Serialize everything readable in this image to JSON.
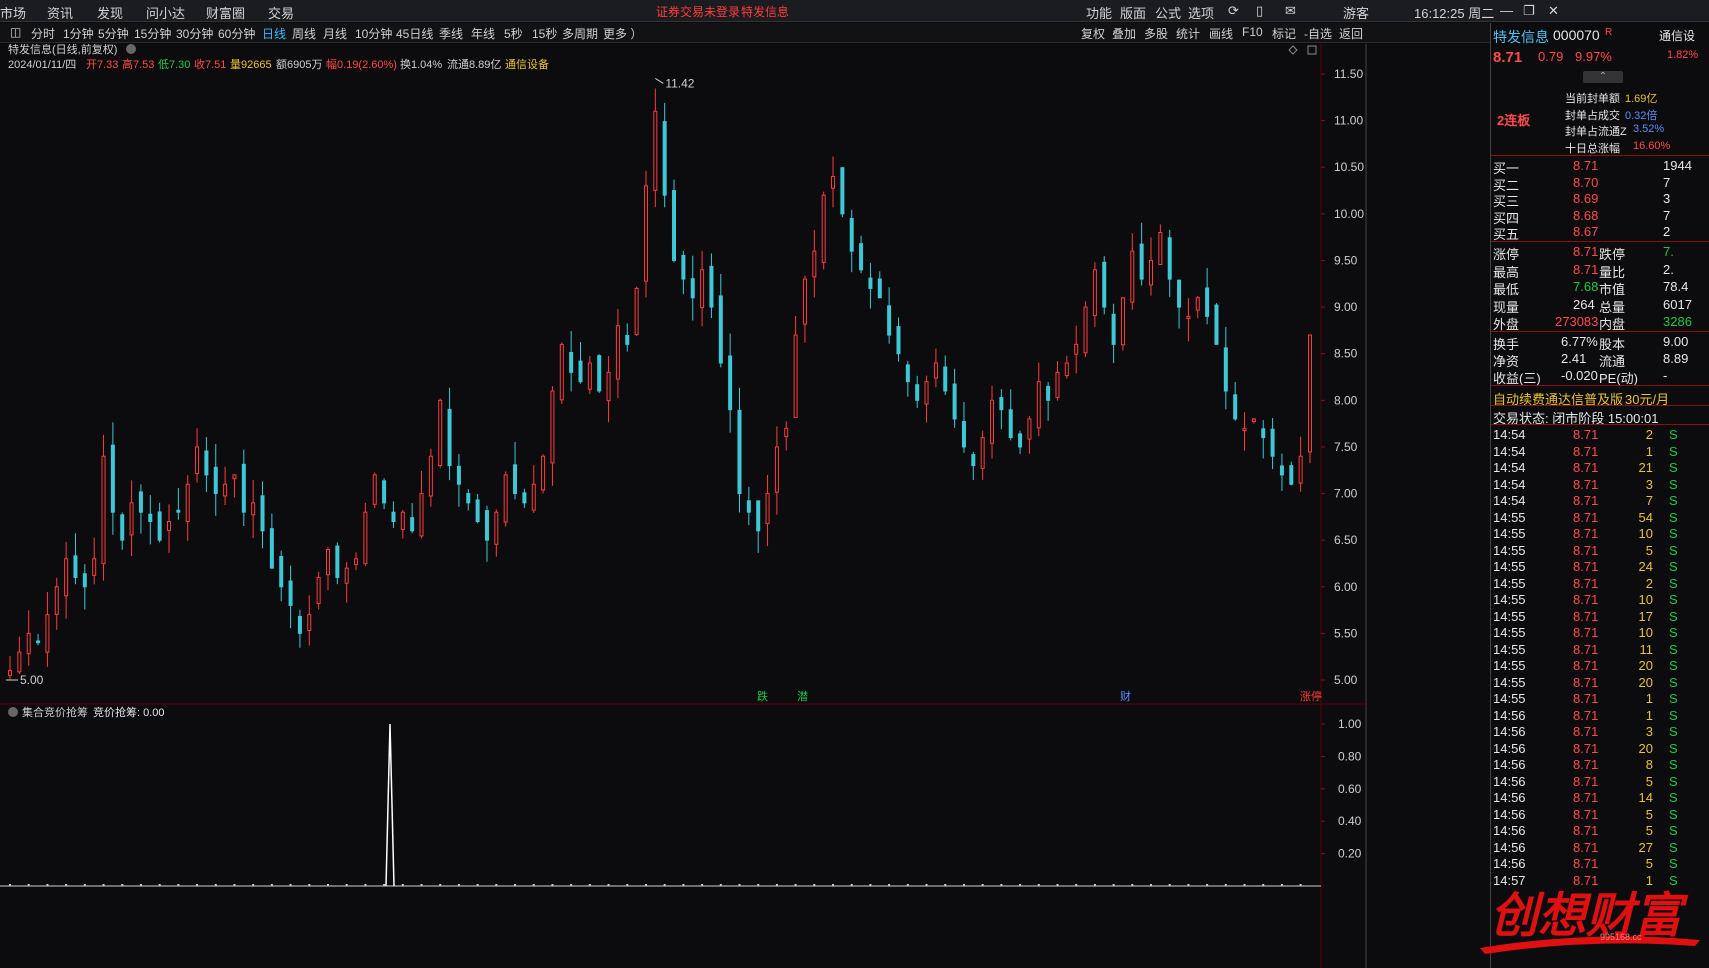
{
  "menubar": {
    "left": [
      "市场",
      "资讯",
      "发现",
      "问小达",
      "财富圈",
      "交易"
    ],
    "notice": "证券交易未登录",
    "stock_link": "特发信息",
    "right": [
      "功能",
      "版面",
      "公式",
      "选项"
    ],
    "user": "游客",
    "clock": "16:12:25 周二"
  },
  "toolbar": {
    "periods": [
      "分时",
      "1分钟",
      "5分钟",
      "15分钟",
      "30分钟",
      "60分钟",
      "日线",
      "周线",
      "月线",
      "10分钟",
      "45日线",
      "季线",
      "年线",
      "5秒",
      "15秒",
      "多周期",
      "更多 ）"
    ],
    "active": "日线",
    "tools": [
      "复权",
      "叠加",
      "多股",
      "统计",
      "画线",
      "F10",
      "标记",
      "-自选",
      "返回"
    ]
  },
  "header": {
    "title": "特发信息(日线,前复权)",
    "date": "2024/01/11/四",
    "open": "开7.33",
    "high": "高7.53",
    "low": "低7.30",
    "close": "收7.51",
    "volume": "量92665",
    "amount": "额6905万",
    "change": "幅0.19(2.60%)",
    "turnover": "换1.04%",
    "float_cap": "流通8.89亿",
    "sector": "通信设备"
  },
  "indicator": {
    "name": "集合竞价抢筹",
    "value_label": "竞价抢筹: 0.00"
  },
  "chart_data": {
    "type": "candlestick",
    "ylim": [
      5.0,
      11.5
    ],
    "y_ticks": [
      "11.50",
      "11.00",
      "10.50",
      "10.00",
      "9.50",
      "9.00",
      "8.50",
      "8.00",
      "7.50",
      "7.00",
      "6.50",
      "6.00",
      "5.50",
      "5.00"
    ],
    "max_label": "11.42",
    "min_label": "5.00",
    "signals": [
      {
        "label": "跌",
        "color": "#1fc84c"
      },
      {
        "label": "潜",
        "color": "#1fc84c"
      },
      {
        "label": "财",
        "color": "#5b8cff"
      },
      {
        "label": "涨停",
        "color": "#ff3b3b"
      }
    ],
    "indicator_ylim": [
      0,
      1.0
    ],
    "indicator_ticks": [
      "1.00",
      "0.80",
      "0.60",
      "0.40",
      "0.20"
    ],
    "close_path": [
      5.1,
      5.3,
      5.5,
      5.4,
      5.7,
      6.0,
      6.3,
      6.1,
      6.0,
      6.3,
      7.4,
      6.8,
      6.5,
      6.9,
      6.8,
      6.7,
      6.5,
      6.7,
      6.8,
      7.1,
      7.5,
      7.2,
      7.0,
      7.1,
      7.2,
      6.8,
      6.9,
      6.6,
      6.2,
      6.0,
      5.8,
      5.5,
      5.7,
      6.1,
      6.4,
      6.1,
      6.2,
      6.3,
      6.8,
      7.2,
      6.9,
      6.7,
      6.8,
      6.6,
      7.0,
      7.4,
      8.0,
      7.3,
      7.1,
      6.9,
      6.7,
      6.5,
      6.8,
      7.2,
      7.0,
      6.9,
      7.1,
      7.4,
      8.1,
      8.6,
      8.3,
      8.2,
      8.4,
      8.1,
      8.3,
      8.8,
      8.6,
      9.2,
      10.3,
      11.1,
      10.2,
      9.5,
      9.3,
      9.1,
      9.4,
      9.0,
      8.4,
      7.9,
      7.0,
      6.8,
      6.6,
      7.0,
      7.5,
      7.7,
      8.7,
      9.3,
      9.6,
      10.2,
      10.4,
      10.0,
      9.6,
      9.4,
      9.2,
      9.1,
      8.7,
      8.5,
      8.2,
      8.0,
      8.2,
      8.4,
      8.1,
      7.8,
      7.5,
      7.3,
      7.6,
      8.0,
      7.9,
      7.6,
      7.5,
      7.8,
      8.2,
      8.0,
      8.3,
      8.4,
      8.6,
      9.0,
      9.4,
      9.0,
      8.6,
      9.1,
      9.6,
      9.3,
      9.5,
      9.8,
      9.3,
      9.0,
      8.9,
      9.1,
      8.9,
      8.6,
      8.1,
      7.8,
      7.7,
      7.8,
      7.6,
      7.4,
      7.2,
      7.1,
      7.4,
      8.7
    ],
    "auction_spike_index": 50,
    "auction_spike_value": 1.0
  },
  "quote": {
    "name": "特发信息",
    "code": "000070",
    "flag": "R",
    "sector_tab": "通信设",
    "price": "8.71",
    "change": "0.79",
    "pct": "9.97%",
    "tag_pct": "1.82%",
    "board": "2连板",
    "seal_stats": [
      {
        "label": "当前封单额",
        "value": "1.69亿"
      },
      {
        "label": "封单占成交",
        "value": "0.32倍"
      },
      {
        "label": "封单占流通Z",
        "value": "3.52%"
      },
      {
        "label": "十日总涨幅",
        "value": "16.60%"
      }
    ],
    "bids": [
      {
        "label": "买一",
        "price": "8.71",
        "vol": "1944"
      },
      {
        "label": "买二",
        "price": "8.70",
        "vol": "7"
      },
      {
        "label": "买三",
        "price": "8.69",
        "vol": "3"
      },
      {
        "label": "买四",
        "price": "8.68",
        "vol": "7"
      },
      {
        "label": "买五",
        "price": "8.67",
        "vol": "2"
      }
    ],
    "stats": [
      {
        "l1": "涨停",
        "v1": "8.71",
        "l2": "跌停",
        "v2": "7."
      },
      {
        "l1": "最高",
        "v1": "8.71",
        "l2": "量比",
        "v2": "2."
      },
      {
        "l1": "最低",
        "v1": "7.68",
        "l2": "市值",
        "v2": "78.4"
      },
      {
        "l1": "现量",
        "v1": "264",
        "l2": "总量",
        "v2": "6017"
      },
      {
        "l1": "外盘",
        "v1": "273083",
        "l2": "内盘",
        "v2": "3286"
      }
    ],
    "stats2": [
      {
        "l1": "换手",
        "v1": "6.77%",
        "l2": "股本",
        "v2": "9.00"
      },
      {
        "l1": "净资",
        "v1": "2.41",
        "l2": "流通",
        "v2": "8.89"
      },
      {
        "l1": "收益(三)",
        "v1": "-0.020",
        "l2": "PE(动)",
        "v2": "-"
      }
    ],
    "promo": "自动续费通达信普及版",
    "promo_price": "30元/月",
    "status": "交易状态: 闭市阶段 15:00:01",
    "ticks": [
      {
        "t": "14:54",
        "p": "8.71",
        "v": "2",
        "s": "S"
      },
      {
        "t": "14:54",
        "p": "8.71",
        "v": "1",
        "s": "S"
      },
      {
        "t": "14:54",
        "p": "8.71",
        "v": "21",
        "s": "S"
      },
      {
        "t": "14:54",
        "p": "8.71",
        "v": "3",
        "s": "S"
      },
      {
        "t": "14:54",
        "p": "8.71",
        "v": "7",
        "s": "S"
      },
      {
        "t": "14:55",
        "p": "8.71",
        "v": "54",
        "s": "S"
      },
      {
        "t": "14:55",
        "p": "8.71",
        "v": "10",
        "s": "S"
      },
      {
        "t": "14:55",
        "p": "8.71",
        "v": "5",
        "s": "S"
      },
      {
        "t": "14:55",
        "p": "8.71",
        "v": "24",
        "s": "S"
      },
      {
        "t": "14:55",
        "p": "8.71",
        "v": "2",
        "s": "S"
      },
      {
        "t": "14:55",
        "p": "8.71",
        "v": "10",
        "s": "S"
      },
      {
        "t": "14:55",
        "p": "8.71",
        "v": "17",
        "s": "S"
      },
      {
        "t": "14:55",
        "p": "8.71",
        "v": "10",
        "s": "S"
      },
      {
        "t": "14:55",
        "p": "8.71",
        "v": "11",
        "s": "S"
      },
      {
        "t": "14:55",
        "p": "8.71",
        "v": "20",
        "s": "S"
      },
      {
        "t": "14:55",
        "p": "8.71",
        "v": "20",
        "s": "S"
      },
      {
        "t": "14:55",
        "p": "8.71",
        "v": "1",
        "s": "S"
      },
      {
        "t": "14:56",
        "p": "8.71",
        "v": "1",
        "s": "S"
      },
      {
        "t": "14:56",
        "p": "8.71",
        "v": "3",
        "s": "S"
      },
      {
        "t": "14:56",
        "p": "8.71",
        "v": "20",
        "s": "S"
      },
      {
        "t": "14:56",
        "p": "8.71",
        "v": "8",
        "s": "S"
      },
      {
        "t": "14:56",
        "p": "8.71",
        "v": "5",
        "s": "S"
      },
      {
        "t": "14:56",
        "p": "8.71",
        "v": "14",
        "s": "S"
      },
      {
        "t": "14:56",
        "p": "8.71",
        "v": "5",
        "s": "S"
      },
      {
        "t": "14:56",
        "p": "8.71",
        "v": "5",
        "s": "S"
      },
      {
        "t": "14:56",
        "p": "8.71",
        "v": "27",
        "s": "S"
      },
      {
        "t": "14:56",
        "p": "8.71",
        "v": "5",
        "s": "S"
      },
      {
        "t": "14:57",
        "p": "8.71",
        "v": "1",
        "s": "S"
      }
    ]
  },
  "watermark": {
    "text": "创想财富",
    "sub": "995168.cc"
  }
}
